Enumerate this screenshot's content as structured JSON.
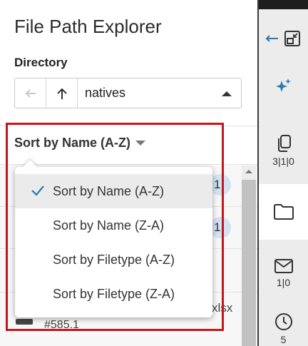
{
  "title": "File Path Explorer",
  "directory": {
    "label": "Directory",
    "value": "natives",
    "back_icon": "arrow-left-icon",
    "up_icon": "arrow-up-icon",
    "dropdown_icon": "caret-up-icon"
  },
  "sort": {
    "label": "Sort by Name (A-Z)",
    "options": [
      {
        "label": "Sort by Name (A-Z)",
        "selected": true
      },
      {
        "label": "Sort by Name (Z-A)",
        "selected": false
      },
      {
        "label": "Sort by Filetype (A-Z)",
        "selected": false
      },
      {
        "label": "Sort by Filetype (Z-A)",
        "selected": false
      }
    ]
  },
  "list": {
    "badge_1": "1",
    "badge_2": "1",
    "partial_ext": "xlsx",
    "partial_id": "#585.1"
  },
  "rail": {
    "items": [
      {
        "icon": "collapse-panel-icon"
      },
      {
        "icon": "sparkle-icon"
      },
      {
        "icon": "copy-icon",
        "count": "3|1|0"
      },
      {
        "icon": "folder-icon"
      },
      {
        "icon": "mail-icon",
        "count": "1|0"
      },
      {
        "icon": "clock-icon",
        "count": "5"
      }
    ]
  },
  "colors": {
    "highlight": "#c4161c",
    "accent": "#2a7ab0",
    "badge": "#cfe3f2"
  }
}
